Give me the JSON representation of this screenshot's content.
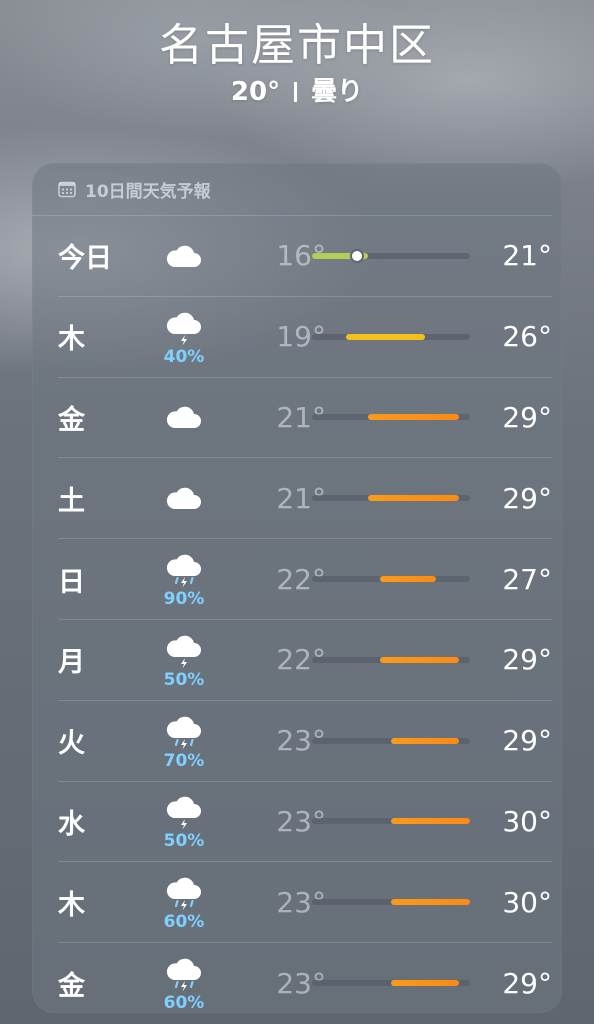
{
  "location": {
    "city": "名古屋市中区",
    "temperature": "20°",
    "condition": "曇り"
  },
  "forecast": {
    "title": "10日間天気予報",
    "header_icon": "calendar-icon",
    "scale_min": 16,
    "scale_max": 30,
    "current_temp": 20,
    "colors": {
      "cool": "#b5cc55",
      "mild": "#f2c21b",
      "warm": "#fa9a1a",
      "hot": "#fb8a16",
      "precip": "#7fd0ff"
    },
    "days": [
      {
        "day": "今日",
        "icon": "cloud-icon",
        "precip": "",
        "low": "16°",
        "high": "21°",
        "low_val": 16,
        "high_val": 21
      },
      {
        "day": "木",
        "icon": "cloud-bolt-icon",
        "precip": "40%",
        "low": "19°",
        "high": "26°",
        "low_val": 19,
        "high_val": 26
      },
      {
        "day": "金",
        "icon": "cloud-icon",
        "precip": "",
        "low": "21°",
        "high": "29°",
        "low_val": 21,
        "high_val": 29
      },
      {
        "day": "土",
        "icon": "cloud-icon",
        "precip": "",
        "low": "21°",
        "high": "29°",
        "low_val": 21,
        "high_val": 29
      },
      {
        "day": "日",
        "icon": "cloud-bolt-rain-icon",
        "precip": "90%",
        "low": "22°",
        "high": "27°",
        "low_val": 22,
        "high_val": 27
      },
      {
        "day": "月",
        "icon": "cloud-bolt-icon",
        "precip": "50%",
        "low": "22°",
        "high": "29°",
        "low_val": 22,
        "high_val": 29
      },
      {
        "day": "火",
        "icon": "cloud-bolt-rain-icon",
        "precip": "70%",
        "low": "23°",
        "high": "29°",
        "low_val": 23,
        "high_val": 29
      },
      {
        "day": "水",
        "icon": "cloud-bolt-icon",
        "precip": "50%",
        "low": "23°",
        "high": "30°",
        "low_val": 23,
        "high_val": 30
      },
      {
        "day": "木",
        "icon": "cloud-bolt-rain-icon",
        "precip": "60%",
        "low": "23°",
        "high": "30°",
        "low_val": 23,
        "high_val": 30
      },
      {
        "day": "金",
        "icon": "cloud-bolt-rain-icon",
        "precip": "60%",
        "low": "23°",
        "high": "29°",
        "low_val": 23,
        "high_val": 29
      }
    ]
  }
}
